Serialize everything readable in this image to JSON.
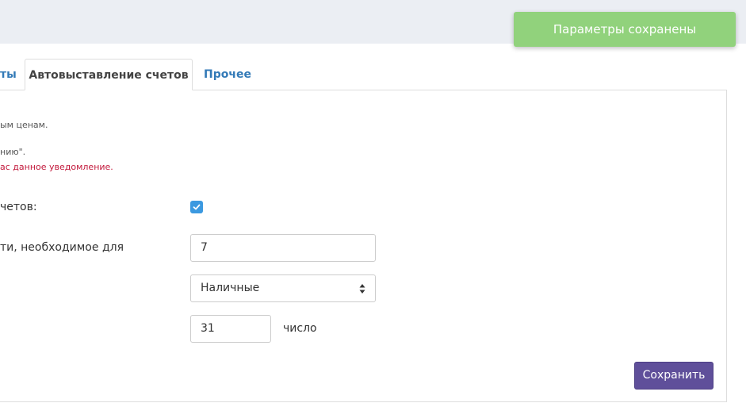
{
  "tabs": {
    "left_partial": "ты",
    "active": "Автовыставление счетов",
    "other": "Прочее"
  },
  "notes": {
    "line1": "ым ценам.",
    "line2": "нию\".",
    "line3_red": "ас данное уведомление."
  },
  "form": {
    "enable_label": "четов:",
    "enable_checked": true,
    "days_label": "ти, необходимое для",
    "days_value": "7",
    "payment_method_value": "Наличные",
    "day_of_month_value": "31",
    "day_of_month_suffix": "число"
  },
  "actions": {
    "save_label": "Сохранить"
  },
  "toast": {
    "message": "Параметры сохранены"
  },
  "colors": {
    "accent_link": "#337ab7",
    "save_button": "#5f4f9a",
    "toast_bg": "#91d27c",
    "warning_text": "#c2183b",
    "checkbox": "#3b99e0"
  },
  "icons": {
    "checkbox": "checkmark-icon",
    "select": "sort-arrows-icon"
  }
}
